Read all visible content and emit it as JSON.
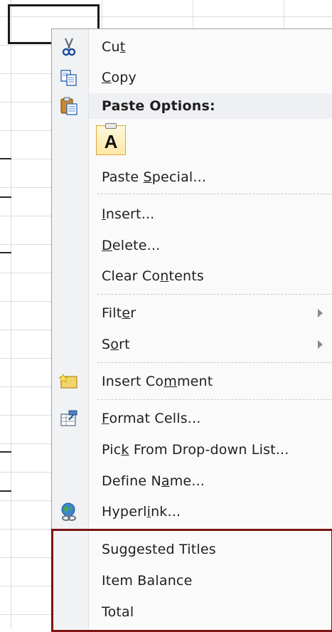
{
  "sheet": {
    "grid_color": "#d8dde4"
  },
  "menu": {
    "items": [
      {
        "label_pre": "Cu",
        "label_ul": "t",
        "label_post": "",
        "icon": "scissors-icon"
      },
      {
        "label_pre": "",
        "label_ul": "C",
        "label_post": "opy",
        "icon": "copy-icon"
      },
      {
        "label": "Paste Options:",
        "icon": "paste-options-icon"
      },
      {
        "paste_button_letter": "A",
        "icon": "paste-keep-text-only-icon"
      },
      {
        "label_pre": "Paste ",
        "label_ul": "S",
        "label_post": "pecial..."
      },
      {
        "label_pre": "",
        "label_ul": "I",
        "label_post": "nsert..."
      },
      {
        "label_pre": "",
        "label_ul": "D",
        "label_post": "elete..."
      },
      {
        "label_pre": "Clear Co",
        "label_ul": "n",
        "label_post": "tents"
      },
      {
        "label_pre": "Filt",
        "label_ul": "e",
        "label_post": "r"
      },
      {
        "label_pre": "S",
        "label_ul": "o",
        "label_post": "rt"
      },
      {
        "label_pre": "Insert Co",
        "label_ul": "m",
        "label_post": "ment",
        "icon": "insert-comment-icon"
      },
      {
        "label_pre": "",
        "label_ul": "F",
        "label_post": "ormat Cells...",
        "icon": "format-cells-icon"
      },
      {
        "label_pre": "Pic",
        "label_ul": "k",
        "label_post": " From Drop-down List..."
      },
      {
        "label_pre": "Define N",
        "label_ul": "a",
        "label_post": "me..."
      },
      {
        "label_pre": "Hyperl",
        "label_ul": "i",
        "label_post": "nk...",
        "icon": "hyperlink-globe-icon"
      },
      {
        "label": "Suggested Titles"
      },
      {
        "label": "Item Balance"
      },
      {
        "label": "Total"
      }
    ],
    "highlight_color": "#7b1412"
  }
}
